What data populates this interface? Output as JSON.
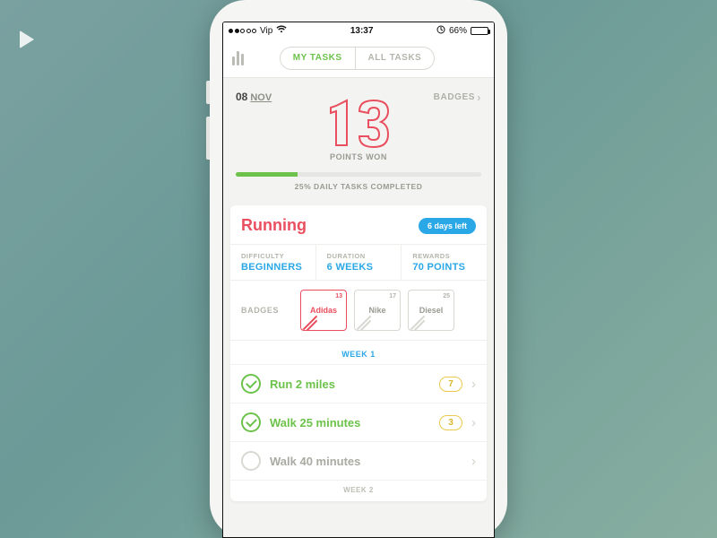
{
  "statusbar": {
    "carrier": "Vip",
    "time": "13:37",
    "battery_pct": "66%"
  },
  "tabs": {
    "my": "MY TASKS",
    "all": "ALL TASKS"
  },
  "summary": {
    "day": "08",
    "month": "NOV",
    "badges_link": "BADGES",
    "points": "13",
    "points_label": "POINTS WON",
    "progress_pct": 25,
    "progress_label": "25% DAILY TASKS COMPLETED"
  },
  "card": {
    "title": "Running",
    "days_left": "6 days left",
    "meta": {
      "difficulty_label": "DIFFICULTY",
      "difficulty": "BEGINNERS",
      "duration_label": "DURATION",
      "duration": "6 WEEKS",
      "rewards_label": "REWARDS",
      "rewards": "70 POINTS"
    },
    "badges_label": "BADGES",
    "badges": [
      {
        "name": "Adidas",
        "num": "13",
        "active": true
      },
      {
        "name": "Nike",
        "num": "17",
        "active": false
      },
      {
        "name": "Diesel",
        "num": "25",
        "active": false
      }
    ],
    "week1_label": "WEEK 1",
    "tasks": [
      {
        "name": "Run 2 miles",
        "points": "7",
        "done": true
      },
      {
        "name": "Walk 25 minutes",
        "points": "3",
        "done": true
      },
      {
        "name": "Walk 40 minutes",
        "points": "",
        "done": false
      }
    ],
    "week2_label": "WEEK 2"
  }
}
